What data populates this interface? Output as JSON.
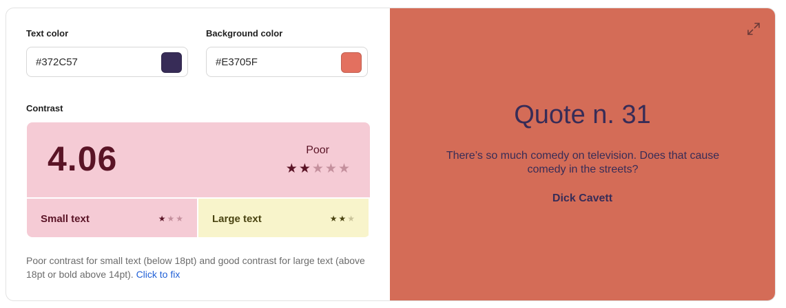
{
  "colors": {
    "text_color": "#372C57",
    "background_color": "#E3705F",
    "preview_bg": "#D46C57",
    "poor_bg": "#F5CBD5",
    "good_bg": "#F8F4CB",
    "star_filled_poor": "#5A1426",
    "star_empty_poor": "#C4909D",
    "star_filled_good": "#4A4412",
    "star_empty_good": "#C9C39A",
    "link": "#1F5FD6"
  },
  "text_color_field": {
    "label": "Text color",
    "value": "#372C57"
  },
  "background_color_field": {
    "label": "Background color",
    "value": "#E3705F"
  },
  "contrast": {
    "label": "Contrast",
    "score": "4.06",
    "rating": "Poor",
    "stars_filled": 2,
    "stars_total": 5,
    "small_text": {
      "label": "Small text",
      "stars_filled": 1,
      "stars_total": 3
    },
    "large_text": {
      "label": "Large text",
      "stars_filled": 2,
      "stars_total": 3
    }
  },
  "note": {
    "text": "Poor contrast for small text (below 18pt) and good contrast for large text (above 18pt or bold above 14pt).",
    "link": "Click to fix"
  },
  "preview": {
    "title": "Quote n. 31",
    "quote": "There’s so much comedy on television. Does that cause comedy in the streets?",
    "author": "Dick Cavett",
    "expand_icon": "expand-icon"
  }
}
